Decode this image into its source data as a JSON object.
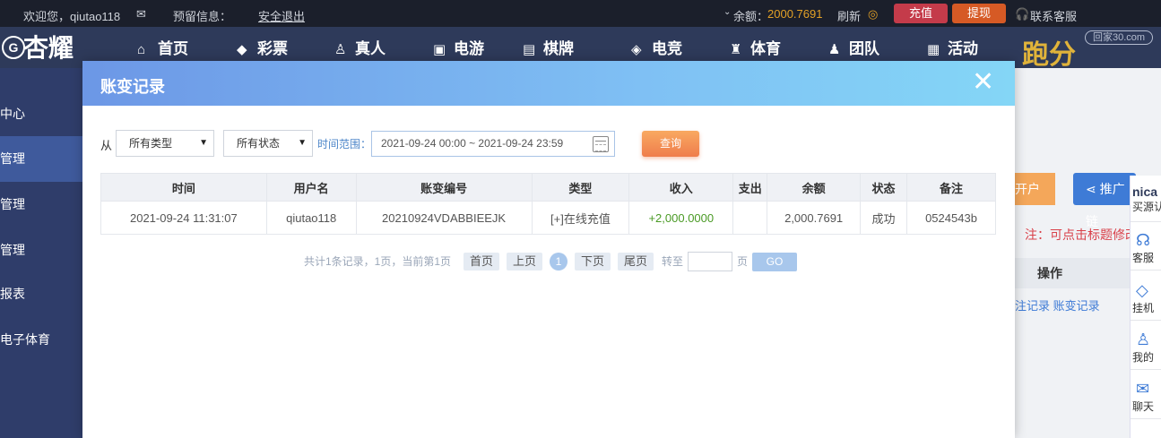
{
  "topbar": {
    "welcome": "欢迎您，qiutao118",
    "reserved_info": "预留信息：",
    "logout": "安全退出",
    "balance_label": "余额：",
    "balance_value": "2000.7691",
    "refresh": "刷新",
    "deposit": "充值",
    "withdraw": "提现",
    "support": "联系客服"
  },
  "nav": {
    "logo": "杏耀",
    "items": [
      "首页",
      "彩票",
      "真人",
      "电游",
      "棋牌",
      "电竞",
      "体育",
      "团队",
      "活动"
    ],
    "paofen": "跑分",
    "watermark": "回家30.com"
  },
  "sidebar": {
    "items": [
      "中心",
      "管理",
      "管理",
      "管理",
      "报表",
      "电子体育"
    ]
  },
  "right_bg": {
    "btn_open": "开户",
    "btn_promote": "推广链",
    "note": "注：可点击标题修改",
    "op_header": "操作",
    "links": "注记录   账变记录"
  },
  "floatpanel": {
    "top": "nica",
    "top2": "买源认",
    "items": [
      "客服",
      "挂机",
      "我的",
      "聊天"
    ]
  },
  "modal": {
    "title": "账变记录",
    "close": "✕",
    "from_label": "从",
    "type_select": "所有类型",
    "status_select": "所有状态",
    "range_label": "时间范围：",
    "range_value": "2021-09-24 00:00 ~ 2021-09-24 23:59",
    "query_button": "查询",
    "table": {
      "headers": [
        "时间",
        "用户名",
        "账变编号",
        "类型",
        "收入",
        "支出",
        "余额",
        "状态",
        "备注"
      ],
      "rows": [
        [
          "2021-09-24 11:31:07",
          "qiutao118",
          "20210924VDABBIEEJK",
          "[+]在线充值",
          "+2,000.0000",
          "",
          "2,000.7691",
          "成功",
          "0524543b"
        ]
      ]
    },
    "pager": {
      "summary": "共计1条记录，1页，当前第1页",
      "first": "首页",
      "prev": "上页",
      "current": "1",
      "next": "下页",
      "last": "尾页",
      "goto_label": "转至",
      "page_unit": "页",
      "go": "GO"
    }
  }
}
